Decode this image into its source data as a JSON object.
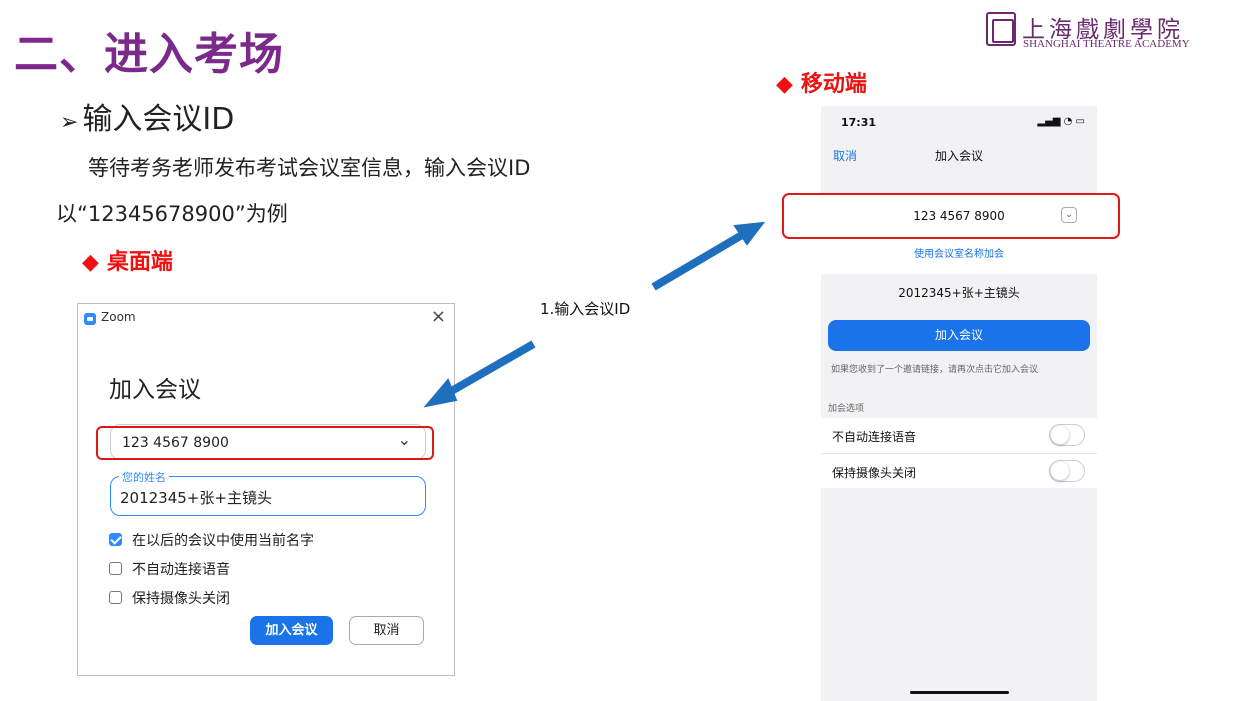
{
  "slide": {
    "title": "二、进入考场",
    "logo_cn": "上海戲劇學院",
    "logo_en": "SHANGHAI THEATRE ACADEMY",
    "bullet": "输入会议ID",
    "intro_line1": "等待考务老师发布考试会议室信息，输入会议ID",
    "intro_line2": "以“12345678900”为例",
    "desktop_label": "桌面端",
    "mobile_label": "移动端",
    "arrow_label": "1.输入会议ID"
  },
  "desktop": {
    "window_title": "Zoom",
    "close_glyph": "×",
    "heading": "加入会议",
    "meeting_id": "123 4567 8900",
    "chevron_glyph": "⌄",
    "name_label": "您的姓名",
    "name_value": "2012345+张+主镜头",
    "checkboxes": [
      {
        "label": "在以后的会议中使用当前名字",
        "checked": true
      },
      {
        "label": "不自动连接语音",
        "checked": false
      },
      {
        "label": "保持摄像头关闭",
        "checked": false
      }
    ],
    "join_button": "加入会议",
    "cancel_button": "取消"
  },
  "mobile": {
    "time": "17:31",
    "status_icons": "▂▄▆ ◔ ▭",
    "nav_cancel": "取消",
    "nav_title": "加入会议",
    "meeting_id": "123 4567 8900",
    "chevron_glyph": "⌄",
    "use_room_name": "使用会议室名称加会",
    "name_value": "2012345+张+主镜头",
    "join_button": "加入会议",
    "hint": "如果您收到了一个邀请链接，请再次点击它加入会议",
    "options_label": "加会选项",
    "options": [
      {
        "label": "不自动连接语音",
        "on": false
      },
      {
        "label": "保持摄像头关闭",
        "on": false
      }
    ]
  },
  "colors": {
    "title": "#7b2a8c",
    "accent_red": "#e11111",
    "zoom_blue": "#1a73e8",
    "arrow_blue": "#1f6fbf"
  },
  "icons": [
    "zoom-logo-icon",
    "close-icon",
    "chevron-down-icon",
    "checkbox-icon",
    "toggle-icon",
    "arrow-icon",
    "diamond-icon",
    "triangle-bullet-icon"
  ]
}
